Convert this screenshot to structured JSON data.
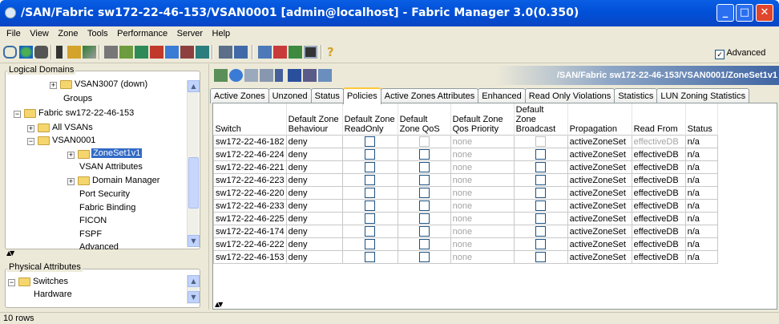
{
  "window": {
    "title": "/SAN/Fabric sw172-22-46-153/VSAN0001 [admin@localhost] - Fabric Manager 3.0(0.350)",
    "minimize": "_",
    "maximize": "□",
    "close": "✕"
  },
  "menu": [
    "File",
    "View",
    "Zone",
    "Tools",
    "Performance",
    "Server",
    "Help"
  ],
  "toolbar": {
    "advanced_label": "Advanced",
    "advanced_checked": true
  },
  "logical_domains": {
    "title": "Logical Domains",
    "items": [
      {
        "label": "VSAN3007 (down)",
        "expander": "+"
      },
      {
        "label": "Groups"
      },
      {
        "label": "Fabric sw172-22-46-153",
        "expander": "−"
      },
      {
        "label": "All VSANs",
        "expander": "+"
      },
      {
        "label": "VSAN0001",
        "expander": "−"
      },
      {
        "label": "ZoneSet1v1",
        "expander": "+"
      },
      {
        "label": "VSAN Attributes"
      },
      {
        "label": "Domain Manager",
        "expander": "+"
      },
      {
        "label": "Port Security"
      },
      {
        "label": "Fabric Binding"
      },
      {
        "label": "FICON"
      },
      {
        "label": "FSPF"
      },
      {
        "label": "Advanced"
      }
    ]
  },
  "physical_attributes": {
    "title": "Physical Attributes",
    "items": [
      {
        "label": "Switches",
        "expander": "−"
      },
      {
        "label": "Hardware"
      }
    ]
  },
  "path_label": "/SAN/Fabric sw172-22-46-153/VSAN0001/ZoneSet1v1",
  "tabs": [
    "Active Zones",
    "Unzoned",
    "Status",
    "Policies",
    "Active Zones Attributes",
    "Enhanced",
    "Read Only Violations",
    "Statistics",
    "LUN Zoning Statistics"
  ],
  "active_tab": "Policies",
  "table": {
    "headers": [
      "Switch",
      "Default Zone Behaviour",
      "Default Zone ReadOnly",
      "Default Zone QoS",
      "Default Zone Qos Priority",
      "Default Zone Broadcast",
      "Propagation",
      "Read From",
      "Status"
    ],
    "rows": [
      [
        "sw172-22-46-182",
        "deny",
        false,
        false,
        "none",
        false,
        "activeZoneSet",
        "effectiveDB",
        "n/a"
      ],
      [
        "sw172-22-46-224",
        "deny",
        false,
        false,
        "none",
        false,
        "activeZoneSet",
        "effectiveDB",
        "n/a"
      ],
      [
        "sw172-22-46-221",
        "deny",
        false,
        false,
        "none",
        false,
        "activeZoneSet",
        "effectiveDB",
        "n/a"
      ],
      [
        "sw172-22-46-223",
        "deny",
        false,
        false,
        "none",
        false,
        "activeZoneSet",
        "effectiveDB",
        "n/a"
      ],
      [
        "sw172-22-46-220",
        "deny",
        false,
        false,
        "none",
        false,
        "activeZoneSet",
        "effectiveDB",
        "n/a"
      ],
      [
        "sw172-22-46-233",
        "deny",
        false,
        false,
        "none",
        false,
        "activeZoneSet",
        "effectiveDB",
        "n/a"
      ],
      [
        "sw172-22-46-225",
        "deny",
        false,
        false,
        "none",
        false,
        "activeZoneSet",
        "effectiveDB",
        "n/a"
      ],
      [
        "sw172-22-46-174",
        "deny",
        false,
        false,
        "none",
        false,
        "activeZoneSet",
        "effectiveDB",
        "n/a"
      ],
      [
        "sw172-22-46-222",
        "deny",
        false,
        false,
        "none",
        false,
        "activeZoneSet",
        "effectiveDB",
        "n/a"
      ],
      [
        "sw172-22-46-153",
        "deny",
        false,
        false,
        "none",
        false,
        "activeZoneSet",
        "effectiveDB",
        "n/a"
      ]
    ]
  },
  "status_bar": "10 rows",
  "colors": {
    "title_bar": "#0050d8",
    "selection": "#316ac5",
    "tab_highlight": "#ffc83c"
  }
}
